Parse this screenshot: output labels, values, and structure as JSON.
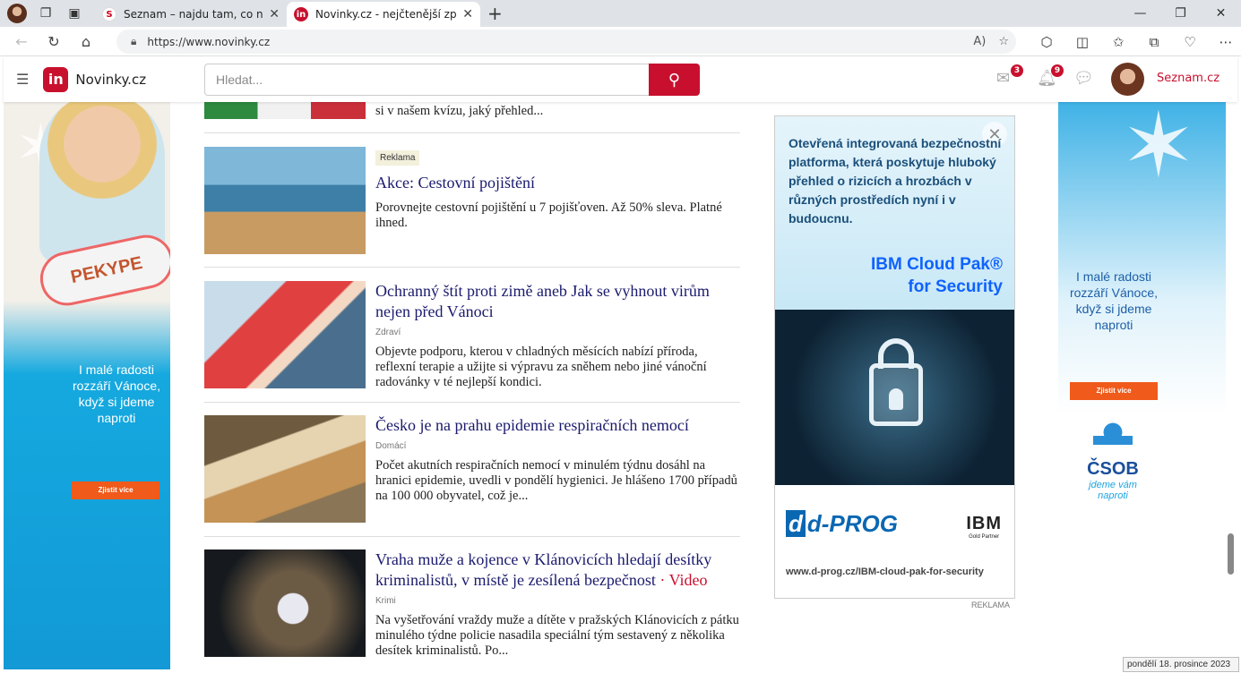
{
  "browser": {
    "tabs": [
      {
        "title": "Seznam – najdu tam, co neznám"
      },
      {
        "title": "Novinky.cz - nejčtenější zprávy n"
      }
    ],
    "url": "https://www.novinky.cz"
  },
  "site": {
    "brand": "Novinky.cz",
    "logo": "in",
    "search_placeholder": "Hledat...",
    "mail_count": "3",
    "notif_count": "9",
    "seznam_link": "Seznam.cz"
  },
  "left_ad": {
    "product_text": "PEKYPE",
    "text": "I malé radosti rozzáří Vánoce, když si jdeme naproti",
    "cta": "Zjistit více"
  },
  "right_ad": {
    "text": "I malé radosti rozzáří Vánoce, když si jdeme naproti",
    "cta": "Zjistit více",
    "brand": "ČSOB",
    "slogan": "jdeme vám naproti"
  },
  "articles": [
    {
      "title": "",
      "category": "",
      "perex": "si v našem kvízu, jaký přehled..."
    },
    {
      "sponsor": "Reklama",
      "title": "Akce: Cestovní pojištění",
      "category": "",
      "perex": "Porovnejte cestovní pojištění u 7 pojišťoven. Až 50% sleva. Platné ihned."
    },
    {
      "title": "Ochranný štít proti zimě aneb Jak se vyhnout virům nejen před Vánoci",
      "category": "Zdraví",
      "perex": "Objevte podporu, kterou v chladných měsících nabízí příroda, reflexní terapie a užijte si výpravu za sněhem nebo jiné vánoční radovánky v té nejlepší kondici."
    },
    {
      "title": "Česko je na prahu epidemie respiračních nemocí",
      "category": "Domácí",
      "perex": "Počet akutních respiračních nemocí v minulém týdnu dosáhl na hranici epidemie, uvedli v pondělí hygienici. Je hlášeno 1700 případů na 100 000 obyvatel, což je..."
    },
    {
      "title": "Vraha muže a kojence v Klánovicích hledají desítky kriminalistů, v místě je zesílená bezpečnost",
      "video": "· Video",
      "category": "Krimi",
      "perex": "Na vyšetřování vraždy muže a dítěte v pražských Klánovicích z pátku minulého týdne policie nasadila speciální tým sestavený z několika desítek kriminalistů. Po..."
    }
  ],
  "ibm_ad": {
    "headline": "Otevřená integrovaná bezpečnostní platforma, která poskytuje hluboký přehled o rizicích a hrozbách v různých prostředích nyní i v budoucnu.",
    "product_line1": "IBM Cloud Pak®",
    "product_line2": "for Security",
    "partner": "d-PROG",
    "ibm": "IBM",
    "ibm_sub": "Gold Partner",
    "url": "www.d-prog.cz/IBM-cloud-pak-for-security",
    "label": "REKLAMA"
  },
  "status": "pondělí 18. prosince 2023",
  "colors": {
    "accent": "#c8102e",
    "link": "#1a1a6e"
  }
}
